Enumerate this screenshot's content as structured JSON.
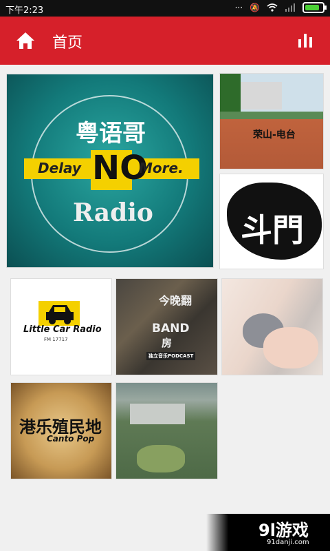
{
  "status": {
    "time": "下午2:23",
    "icons": [
      "dots-icon",
      "mute-icon",
      "wifi-icon",
      "signal-icon",
      "battery-icon"
    ],
    "battery_level": 0.85
  },
  "header": {
    "title": "首页",
    "left_icon": "home-icon",
    "right_icon": "equalizer-icon",
    "accent": "#d6202a"
  },
  "tiles": [
    {
      "id": "cantonese-bro",
      "line1": "粤语哥",
      "line2": "Delay",
      "line3": "NO",
      "line4": "More.",
      "line5": "Radio"
    },
    {
      "id": "rongshan",
      "label": "荣山-电台"
    },
    {
      "id": "doumen",
      "label": "斗門"
    },
    {
      "id": "little-car",
      "label": "Little Car Radio",
      "sub": "FM 17717"
    },
    {
      "id": "band-room",
      "line1": "今晚翻",
      "line2": "BAND",
      "line3": "房",
      "footer": "独立音乐PODCAST"
    },
    {
      "id": "kitten",
      "label": ""
    },
    {
      "id": "canto-pop",
      "line1": "港乐殖民地",
      "line2": "Canto Pop"
    },
    {
      "id": "campus-aerial",
      "label": ""
    }
  ],
  "ad": {
    "logo": "9l游戏",
    "url": "91danji.com"
  }
}
